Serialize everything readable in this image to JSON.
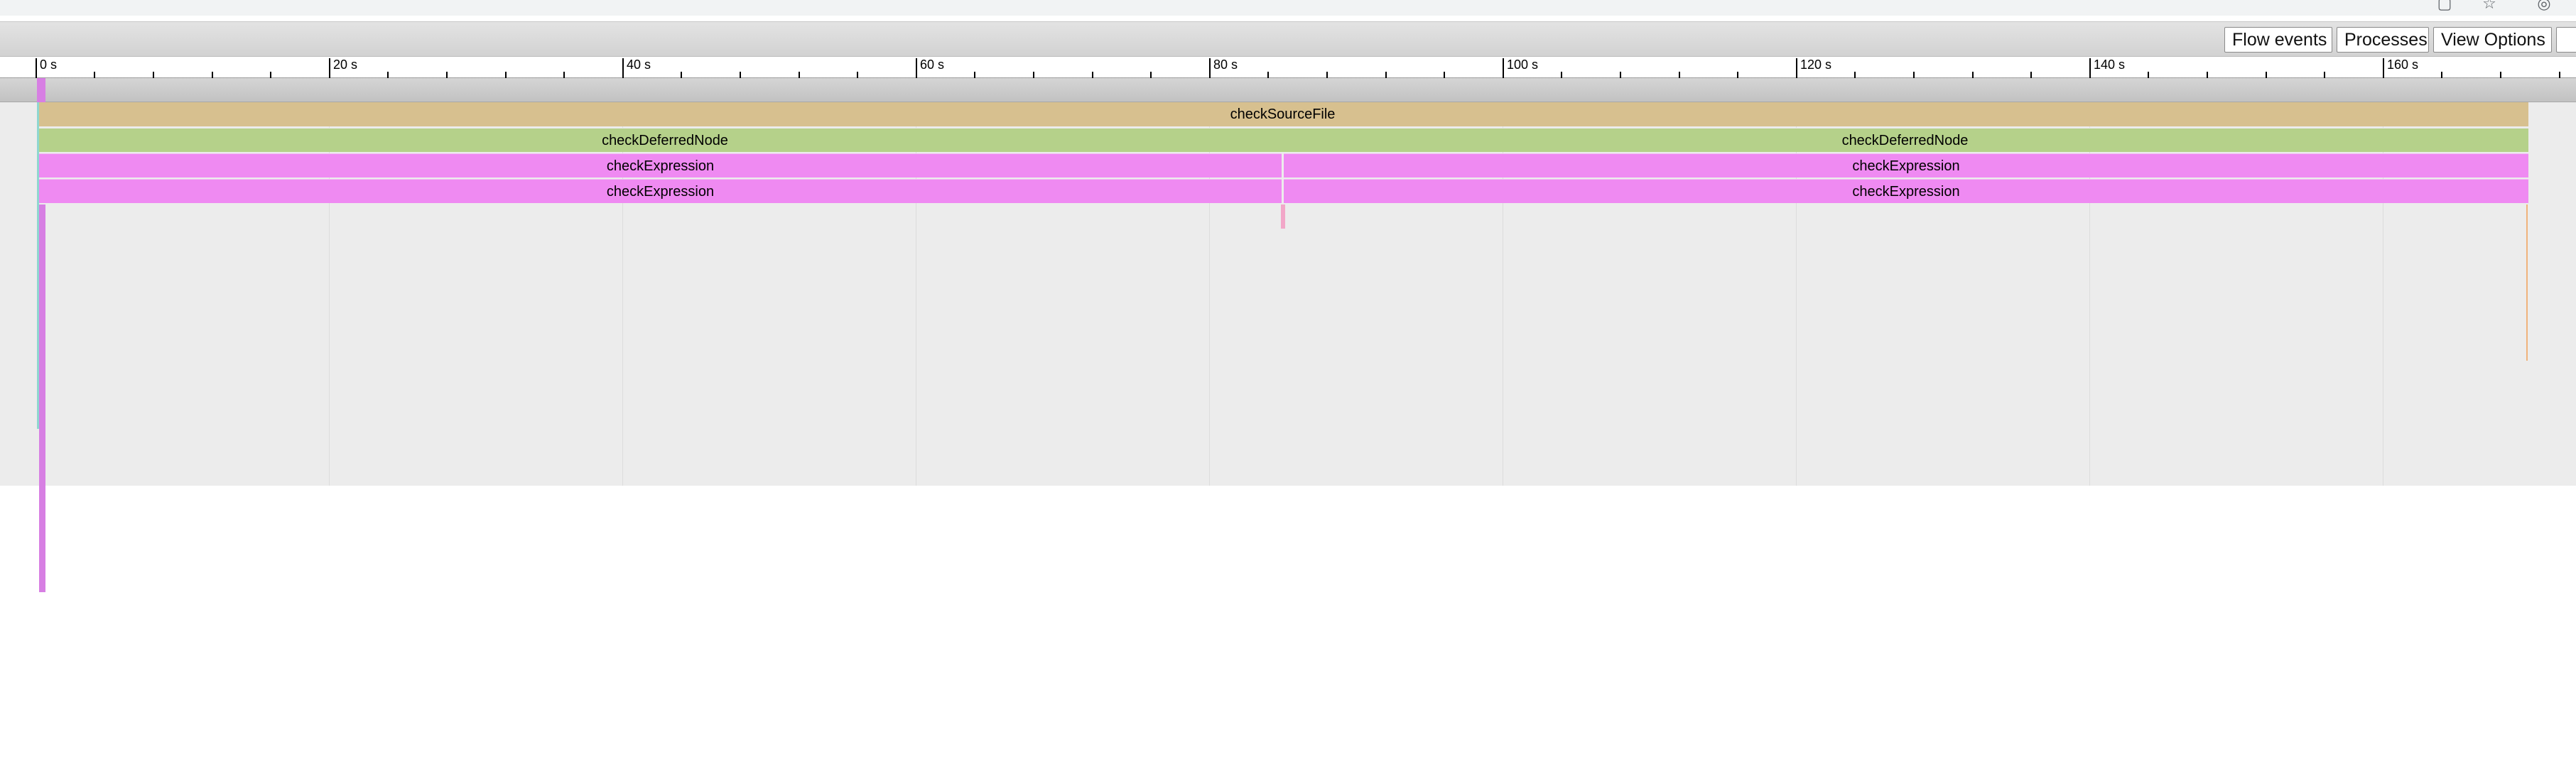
{
  "browser": {
    "icons": [
      "bookmark-icon",
      "star-icon",
      "account-icon"
    ]
  },
  "toolbar": {
    "flow_events_label": "Flow events",
    "processes_label": "Processes",
    "view_options_label": "View Options"
  },
  "ruler": {
    "ticks": [
      "0 s",
      "20 s",
      "40 s",
      "60 s",
      "80 s",
      "100 s",
      "120 s",
      "140 s",
      "160 s"
    ]
  },
  "tracks": {
    "depth0": [
      {
        "label": "checkSourceFile"
      }
    ],
    "depth1": [
      {
        "label": "checkDeferredNode"
      },
      {
        "label": "checkDeferredNode"
      }
    ],
    "depth2": [
      {
        "label": "checkExpression"
      },
      {
        "label": "checkExpression"
      }
    ],
    "depth3": [
      {
        "label": "checkExpression"
      },
      {
        "label": "checkExpression"
      }
    ]
  },
  "colors": {
    "checkSourceFile": "#d7c08f",
    "checkDeferredNode": "#b5d18a",
    "checkExpression": "#ef8af2",
    "track_background": "#ececec"
  }
}
